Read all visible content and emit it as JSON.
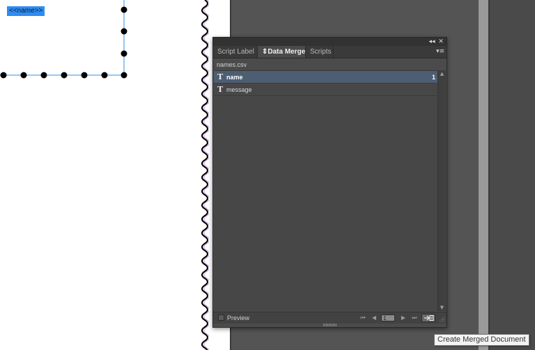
{
  "document": {
    "placeholder_text": "<<name>>",
    "selection_color": "#2f8cf0"
  },
  "panel": {
    "tabs": [
      {
        "label": "Script Label",
        "active": false
      },
      {
        "label": "Data Merge",
        "active": true
      },
      {
        "label": "Scripts",
        "active": false
      }
    ],
    "titlebar": {
      "collapse_icon": "◂◂",
      "close_icon": "✕"
    },
    "menu_icon": "▾≡",
    "data_source": "names.csv",
    "fields": [
      {
        "type_icon": "T",
        "name": "name",
        "count": "1",
        "selected": true
      },
      {
        "type_icon": "T",
        "name": "message",
        "count": "",
        "selected": false
      }
    ],
    "footer": {
      "preview_label": "Preview",
      "preview_checked": false,
      "record_number": "1",
      "first_icon": "⏮",
      "prev_icon": "◀",
      "next_icon": "▶",
      "last_icon": "⏭"
    }
  },
  "tooltip": {
    "text": "Create Merged Document"
  },
  "colors": {
    "pasteboard": "#545454",
    "panel_bg": "#4b4b4b",
    "selected_row": "#4d5e73"
  }
}
